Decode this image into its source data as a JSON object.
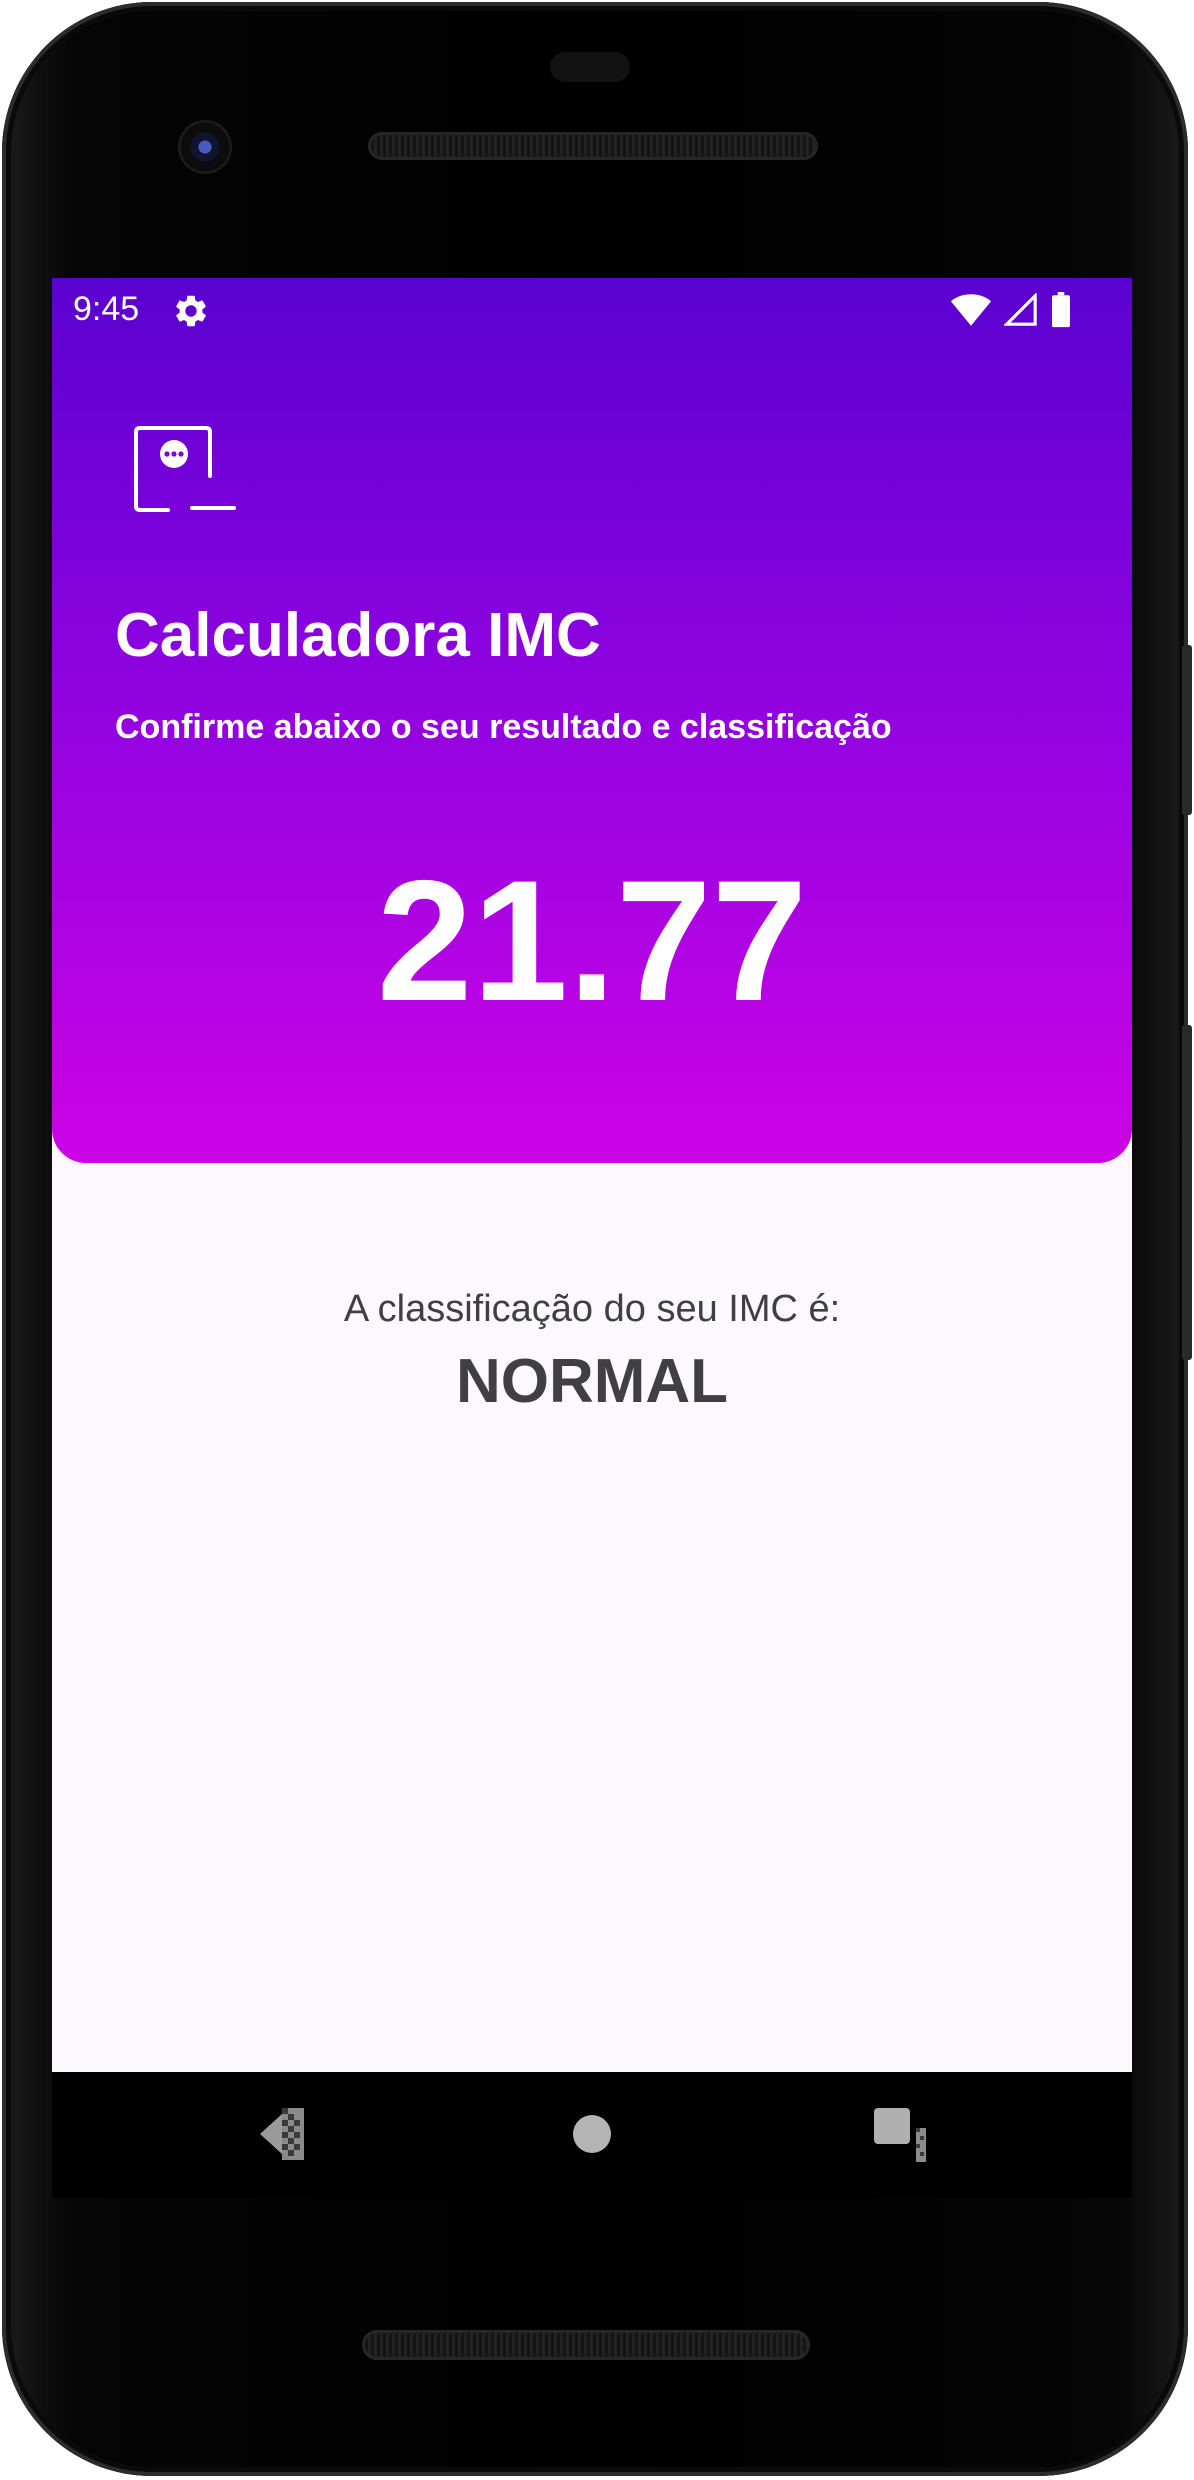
{
  "status_bar": {
    "time": "9:45",
    "icons": [
      "settings-icon",
      "wifi-icon",
      "signal-icon",
      "battery-icon"
    ]
  },
  "header": {
    "logo_icon": "chat-frame-logo-icon",
    "title": "Calculadora IMC",
    "subtitle": "Confirme abaixo o seu resultado e classificação",
    "bmi_value": "21.77"
  },
  "result": {
    "label": "A classificação do seu IMC é:",
    "classification": "NORMAL"
  },
  "navigation_bar": {
    "icons": [
      "back-icon",
      "home-icon",
      "recents-icon"
    ]
  },
  "colors": {
    "gradient_top": "#5a02d0",
    "gradient_bottom": "#cc03e6",
    "background": "#fdf8fd",
    "text_dark": "#3f3f44",
    "text_light": "#ffffff"
  }
}
